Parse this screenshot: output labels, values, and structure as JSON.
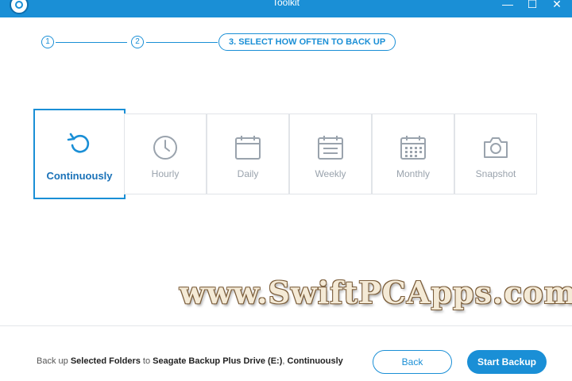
{
  "window": {
    "title": "Toolkit",
    "min_glyph": "—",
    "max_glyph": "☐",
    "close_glyph": "✕"
  },
  "stepper": {
    "step1": "1",
    "step2": "2",
    "step3": "3. SELECT HOW OFTEN TO BACK UP"
  },
  "options": [
    {
      "label": "Continuously",
      "icon": "refresh-icon",
      "selected": true
    },
    {
      "label": "Hourly",
      "icon": "clock-icon",
      "selected": false
    },
    {
      "label": "Daily",
      "icon": "calendar-day-icon",
      "selected": false
    },
    {
      "label": "Weekly",
      "icon": "calendar-week-icon",
      "selected": false
    },
    {
      "label": "Monthly",
      "icon": "calendar-month-icon",
      "selected": false
    },
    {
      "label": "Snapshot",
      "icon": "camera-icon",
      "selected": false
    }
  ],
  "watermark": "www.SwiftPCApps.com",
  "footer": {
    "prefix": "Back up ",
    "source": "Selected Folders",
    "middle": " to ",
    "target": "Seagate Backup Plus Drive (E:)",
    "sep": ", ",
    "frequency": "Continuously",
    "back_label": "Back",
    "start_label": "Start Backup"
  },
  "colors": {
    "accent": "#1a8fd6",
    "icon_gray": "#9aa3ad"
  }
}
